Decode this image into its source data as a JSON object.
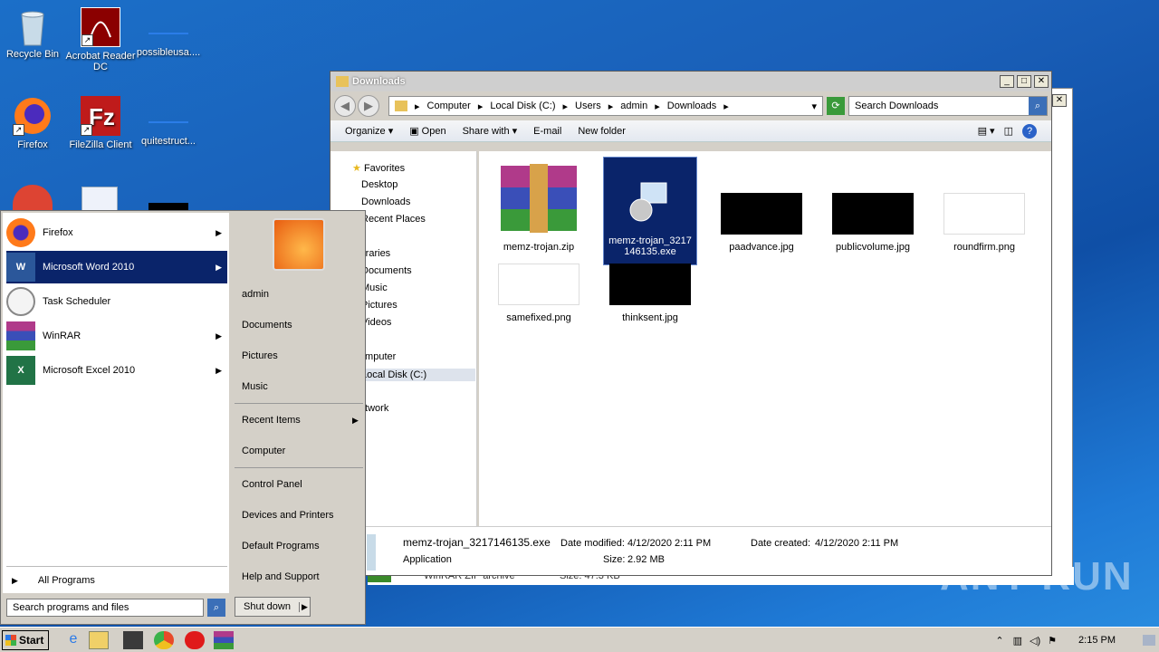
{
  "desktop": {
    "icons": [
      {
        "label": "Recycle Bin"
      },
      {
        "label": "Acrobat Reader DC"
      },
      {
        "label": "possibleusa...."
      },
      {
        "label": "Firefox"
      },
      {
        "label": "FileZilla Client"
      },
      {
        "label": "quitestruct..."
      }
    ],
    "watermark": "ANY RUN"
  },
  "explorer": {
    "title": "Downloads",
    "breadcrumb": [
      "Computer",
      "Local Disk (C:)",
      "Users",
      "admin",
      "Downloads"
    ],
    "search_placeholder": "Search Downloads",
    "toolbar": {
      "organize": "Organize",
      "open": "Open",
      "share_with": "Share with",
      "email": "E-mail",
      "new_folder": "New folder"
    },
    "nav": {
      "favorites": "Favorites",
      "desktop": "Desktop",
      "downloads": "Downloads",
      "recent_places": "Recent Places",
      "libraries": "Libraries",
      "documents": "Documents",
      "music": "Music",
      "pictures": "Pictures",
      "videos": "Videos",
      "computer": "Computer",
      "local_disk": "Local Disk (C:)",
      "network": "Network"
    },
    "files": [
      {
        "name": "memz-trojan.zip"
      },
      {
        "name": "memz-trojan_3217146135.exe",
        "selected": true
      },
      {
        "name": "paadvance.jpg"
      },
      {
        "name": "publicvolume.jpg"
      },
      {
        "name": "roundfirm.png"
      },
      {
        "name": "samefixed.png"
      },
      {
        "name": "thinksent.jpg"
      }
    ],
    "details": {
      "filename": "memz-trojan_3217146135.exe",
      "type": "Application",
      "date_modified_label": "Date modified:",
      "date_modified": "4/12/2020 2:11 PM",
      "date_created_label": "Date created:",
      "date_created": "4/12/2020 2:11 PM",
      "size_label": "Size:",
      "size": "2.92 MB"
    },
    "behind_row": {
      "type": "WinRAR ZIP archive",
      "size": "Size: 47.3 KB"
    }
  },
  "start_menu": {
    "programs": [
      {
        "label": "Firefox",
        "submenu": true
      },
      {
        "label": "Microsoft Word 2010",
        "submenu": true,
        "highlighted": true
      },
      {
        "label": "Task Scheduler",
        "submenu": false
      },
      {
        "label": "WinRAR",
        "submenu": true
      },
      {
        "label": "Microsoft Excel 2010",
        "submenu": true
      }
    ],
    "all_programs": "All Programs",
    "search_placeholder": "Search programs and files",
    "right": {
      "user": "admin",
      "documents": "Documents",
      "pictures": "Pictures",
      "music": "Music",
      "recent_items": "Recent Items",
      "computer": "Computer",
      "control_panel": "Control Panel",
      "devices_printers": "Devices and Printers",
      "default_programs": "Default Programs",
      "help_support": "Help and Support"
    },
    "shutdown": "Shut down"
  },
  "taskbar": {
    "start": "Start",
    "clock": "2:15 PM"
  }
}
